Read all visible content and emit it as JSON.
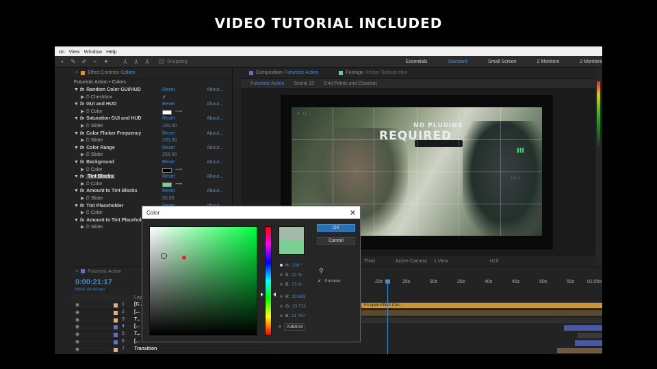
{
  "banner": {
    "title": "VIDEO TUTORIAL INCLUDED"
  },
  "menu": [
    "on",
    "View",
    "Window",
    "Help"
  ],
  "toolbar": {
    "snapping": "Snapping",
    "workspaces": [
      "Essentials",
      "Standard",
      "Small Screen",
      "2 Monitors",
      "2 Monitors"
    ],
    "active_workspace": "Standard"
  },
  "effect_controls": {
    "tab_label": "Effect Controls",
    "tab_target": "Colors",
    "subtitle": "Futuristic Action • Colors",
    "reset": "Reset",
    "about": "About...",
    "rows": [
      {
        "type": "effect",
        "name": "Random Color GUI/HUD",
        "fx": "fx"
      },
      {
        "type": "prop",
        "name": "Checkbox",
        "check": "✓"
      },
      {
        "type": "effect",
        "name": "GUI and HUD",
        "fx": "fx"
      },
      {
        "type": "prop",
        "name": "Color",
        "swatch": "#ffffff"
      },
      {
        "type": "effect",
        "name": "Saturation GUI and HUD",
        "fx": "fx"
      },
      {
        "type": "prop",
        "name": "Slider",
        "value": "100,00"
      },
      {
        "type": "effect",
        "name": "Color Flicker Frequency",
        "fx": "fx"
      },
      {
        "type": "prop",
        "name": "Slider",
        "value": "100,00"
      },
      {
        "type": "effect",
        "name": "Color Range",
        "fx": "fx"
      },
      {
        "type": "prop",
        "name": "Slider",
        "value": "255,00"
      },
      {
        "type": "effect",
        "name": "Background",
        "fx": "fx"
      },
      {
        "type": "prop",
        "name": "Color",
        "swatch": "#000000"
      },
      {
        "type": "effect",
        "name": "Tint Blocks",
        "fx": "fx",
        "selected": true
      },
      {
        "type": "prop",
        "name": "Color",
        "swatch": "#7ccf92"
      },
      {
        "type": "effect",
        "name": "Amount to Tint Blocks",
        "fx": "fx"
      },
      {
        "type": "prop",
        "name": "Slider",
        "value": "30,00"
      },
      {
        "type": "effect",
        "name": "Tint Placeholder",
        "fx": "fx"
      },
      {
        "type": "prop",
        "name": "Color",
        "swatch": ""
      },
      {
        "type": "effect",
        "name": "Amount to Tint Placeholder",
        "fx": "fx"
      },
      {
        "type": "prop",
        "name": "Slider",
        "value": ""
      }
    ]
  },
  "composition": {
    "tab_label": "Composition",
    "tab_name": "Futuristic Action",
    "footage_label": "Footage",
    "footage_name": "Kristar Tactical.mp4",
    "crumbs": [
      "Futuristic Action",
      "Scene 13",
      "Grid Points and Closeset"
    ],
    "overlay_small": "NO PLUGINS",
    "overlay_big": "REQUIRED",
    "viewbar": [
      "Third",
      "Active Camera",
      "1 View",
      "+0,0"
    ]
  },
  "timeline": {
    "tab_label": "Futuristic Action",
    "timecode": "0:00:21:17",
    "fps": "00647 (30.00 fps)",
    "header": "Layer Name",
    "ruler": [
      "20s",
      "25s",
      "30s",
      "35s",
      "40s",
      "45s",
      "50s",
      "55s",
      "01:00s"
    ],
    "clip_label": "F3 open Effect Con...",
    "layers": [
      {
        "num": "1",
        "name": "[C...",
        "color": "#e0b080"
      },
      {
        "num": "2",
        "name": "[...",
        "color": "#e0b080"
      },
      {
        "num": "3",
        "name": "T...",
        "color": "#e0b080"
      },
      {
        "num": "4",
        "name": "[...",
        "color": "#6b6bc8"
      },
      {
        "num": "5",
        "name": "T...",
        "color": "#6b6bc8"
      },
      {
        "num": "6",
        "name": "[...",
        "color": "#6b6bc8"
      },
      {
        "num": "7",
        "name": "Transition",
        "color": "#e0b080"
      }
    ]
  },
  "color_dialog": {
    "title": "Color",
    "close": "✕",
    "ok": "OK",
    "cancel": "Cancel",
    "preview": "Preview",
    "preview_check": "✓",
    "new_color": "#a3b9a9",
    "old_color": "#7ccf92",
    "values": [
      {
        "label": "H:",
        "value": "138 °",
        "on": true
      },
      {
        "label": "S:",
        "value": "12 %",
        "on": false
      },
      {
        "label": "B:",
        "value": "73 %",
        "on": false
      },
      {
        "label": "R:",
        "value": "20 883",
        "on": false
      },
      {
        "label": "G:",
        "value": "23 773",
        "on": false
      },
      {
        "label": "B:",
        "value": "21 767",
        "on": false
      }
    ],
    "hex_label": "#",
    "hex": "A3B9A9"
  }
}
